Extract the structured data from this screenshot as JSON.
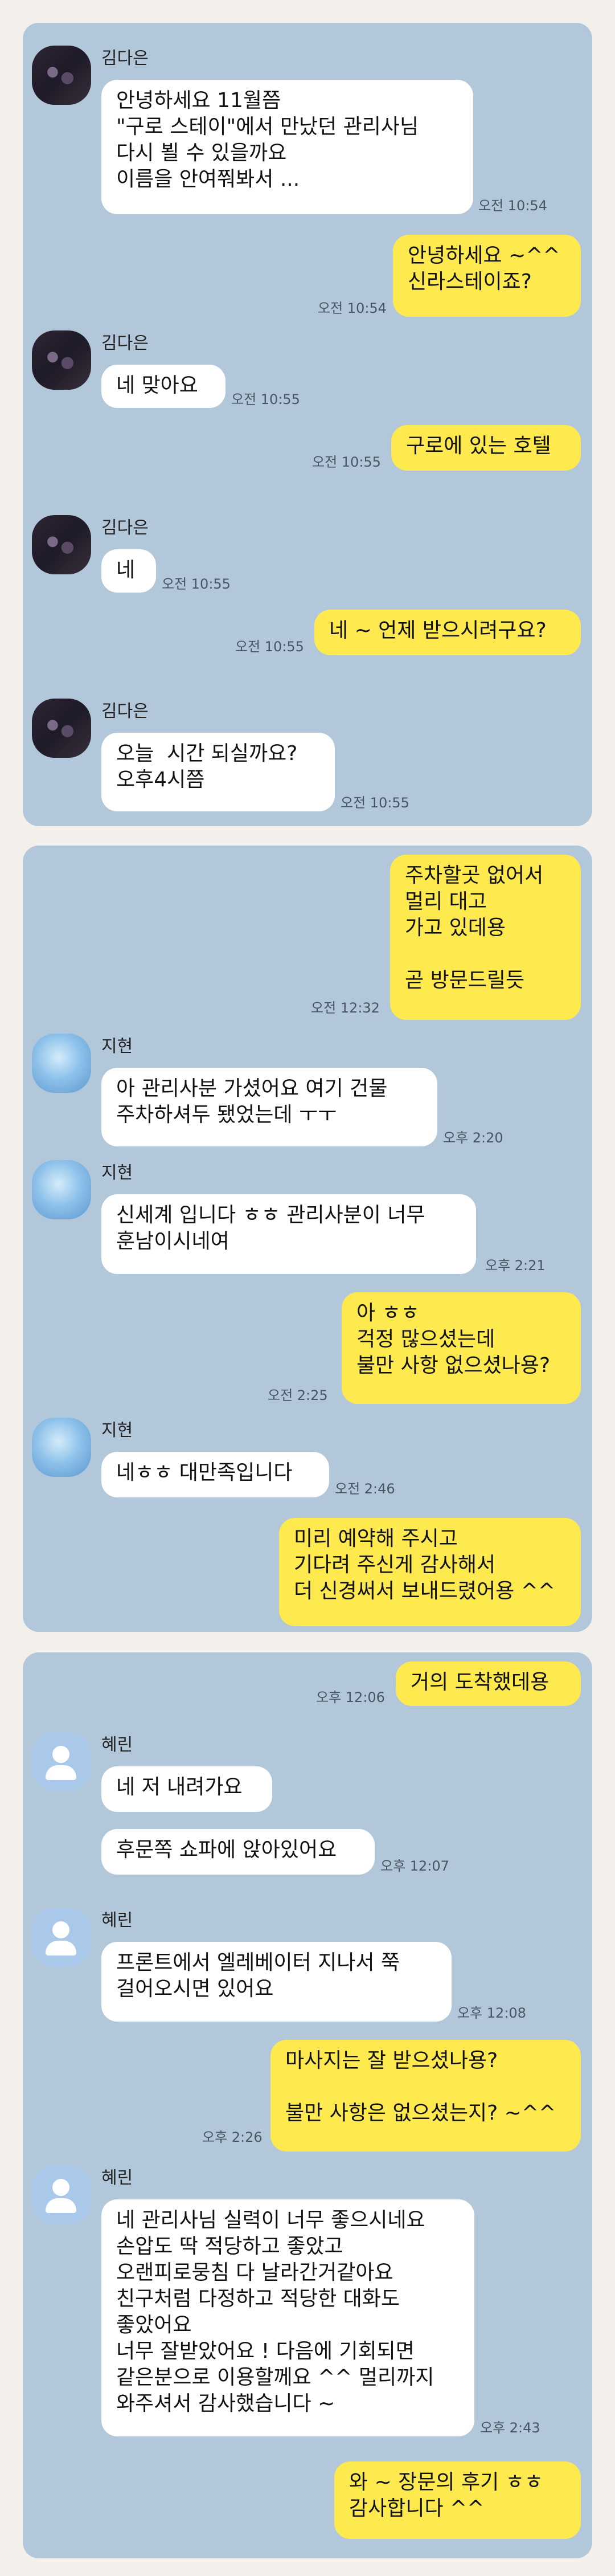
{
  "contacts": {
    "c1": "김다은",
    "c2": "지현",
    "c3": "혜린"
  },
  "chat1": {
    "m1": {
      "text": "안녕하세요 11월쯤\n\"구로 스테이\"에서 만났던 관리사님\n다시 뵐 수 있을까요\n이름을 안여쭤봐서 ...",
      "time": "오전 10:54"
    },
    "m2": {
      "text": "안녕하세요 ~^^\n신라스테이죠?",
      "time": "오전 10:54"
    },
    "m3": {
      "text": "네 맞아요",
      "time": "오전 10:55"
    },
    "m4": {
      "text": "구로에 있는 호텔",
      "time": "오전 10:55"
    },
    "m5": {
      "text": "네",
      "time": "오전 10:55"
    },
    "m6": {
      "text": "네 ~ 언제 받으시려구요?",
      "time": "오전 10:55"
    },
    "m7": {
      "text": "오늘  시간 되실까요?\n오후4시쯤",
      "time": "오전 10:55"
    }
  },
  "chat2": {
    "m1": {
      "text": "주차할곳 없어서\n멀리 대고\n가고 있데용\n\n곧 방문드릴듯",
      "time": "오전 12:32"
    },
    "m2": {
      "text": "아 관리사분 가셨어요 여기 건물\n주차하셔두 됐었는데 ㅜㅜ",
      "time": "오후 2:20"
    },
    "m3": {
      "text": "신세계 입니다 ㅎㅎ 관리사분이 너무\n훈남이시네여",
      "time": "오후 2:21"
    },
    "m4": {
      "text": "아 ㅎㅎ\n걱정 많으셨는데\n불만 사항 없으셨나용?",
      "time": "오전 2:25"
    },
    "m5": {
      "text": "네ㅎㅎ 대만족입니다",
      "time": "오전 2:46"
    },
    "m6": {
      "text": "미리 예약해 주시고\n기다려 주신게 감사해서\n더 신경써서 보내드렸어용 ^^"
    }
  },
  "chat3": {
    "m1": {
      "text": "거의 도착했데용",
      "time": "오후 12:06"
    },
    "m2": {
      "text": "네 저 내려가요"
    },
    "m3": {
      "text": "후문쪽 쇼파에 앉아있어요",
      "time": "오후 12:07"
    },
    "m4": {
      "text": "프론트에서 엘레베이터 지나서 쭉\n걸어오시면 있어요",
      "time": "오후 12:08"
    },
    "m5": {
      "text": "마사지는 잘 받으셨나용?\n\n불만 사항은 없으셨는지? ~^^",
      "time": "오후 2:26"
    },
    "m6": {
      "text": "네 관리사님 실력이 너무 좋으시네요\n손압도 딱 적당하고 좋았고\n오랜피로뭉침 다 날라간거같아요\n친구처럼 다정하고 적당한 대화도\n좋았어요\n너무 잘받았어요 ! 다음에 기회되면\n같은분으로 이용할께요 ^^ 멀리까지\n와주셔서 감사했습니다 ~",
      "time": "오후 2:43"
    },
    "m7": {
      "text": "와 ~ 장문의 후기 ㅎㅎ\n감사합니다 ^^"
    }
  }
}
